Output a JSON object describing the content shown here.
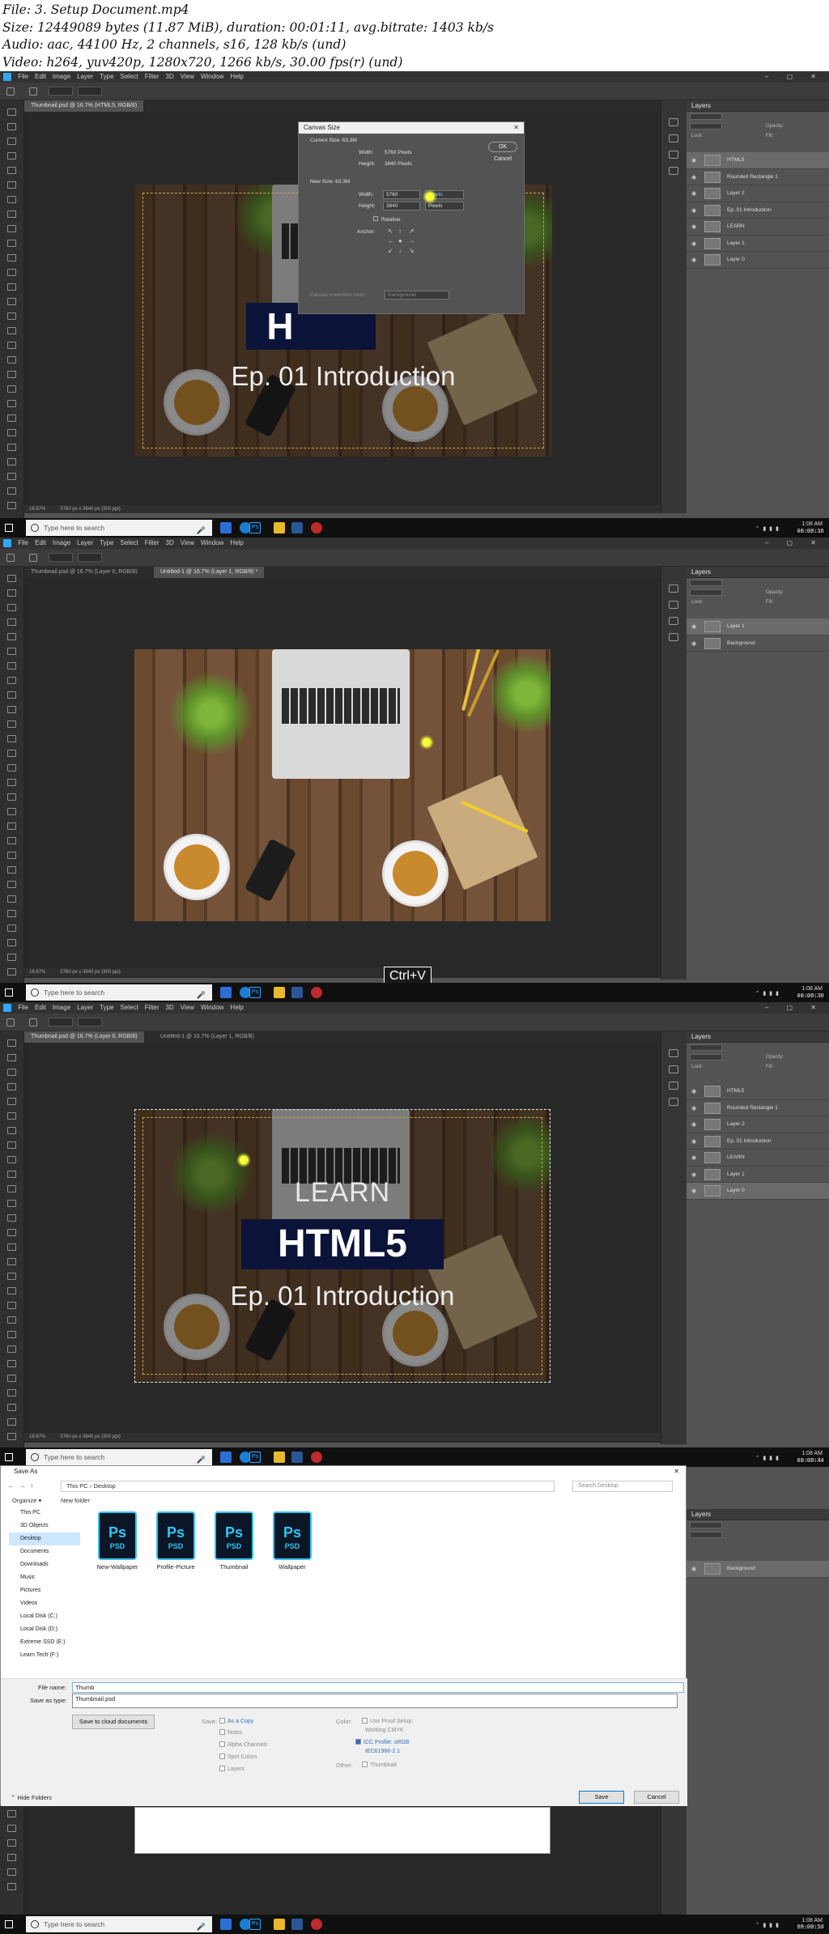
{
  "info": {
    "line1": "File: 3. Setup Document.mp4",
    "line2": "Size: 12449089 bytes (11.87 MiB), duration: 00:01:11, avg.bitrate: 1403 kb/s",
    "line3": "Audio: aac, 44100 Hz, 2 channels, s16, 128 kb/s (und)",
    "line4": "Video: h264, yuv420p, 1280x720, 1266 kb/s, 30.00 fps(r) (und)"
  },
  "menu": [
    "File",
    "Edit",
    "Image",
    "Layer",
    "Type",
    "Select",
    "Filter",
    "3D",
    "View",
    "Window",
    "Help"
  ],
  "winbtns": "– ▢ ✕",
  "layers_title": "Layers",
  "kind_label": "Kind",
  "normal_label": "Normal",
  "opacity_label": "Opacity:",
  "fill_label": "Fill:",
  "lock_label": "Lock:",
  "artwork": {
    "learn": "LEARN",
    "html": "HTML5",
    "ep": "Ep. 01 Introduction",
    "html_cropped": "H"
  },
  "frame1": {
    "tab": "Thumbnail.psd @ 16.7% (HTML5, RGB/8)",
    "status": [
      "16.67%",
      "5760 px x 3840 px (300 ppi)"
    ],
    "timestamp": "00:00:16",
    "layers": [
      "HTML5",
      "Rounded Rectangle 1",
      "Layer 2",
      "Ep. 01 Introduction",
      "LEARN",
      "Layer 1",
      "Layer 0"
    ],
    "dialog": {
      "title": "Canvas Size",
      "current_size": "Current Size: 63.3M",
      "width_label": "Width:",
      "width_val": "5760 Pixels",
      "height_label": "Height:",
      "height_val": "3840 Pixels",
      "new_size": "New Size: 63.3M",
      "new_width": "5760",
      "new_height": "3840",
      "units": "Pixels",
      "relative": "Relative",
      "anchor": "Anchor:",
      "ext_color": "Canvas extension color:",
      "ext_val": "Background",
      "ok": "OK",
      "cancel": "Cancel"
    }
  },
  "frame2": {
    "tabs": [
      "Thumbnail.psd @ 16.7% (Layer 0, RGB/8)",
      "Untitled-1 @ 16.7% (Layer 1, RGB/8) *"
    ],
    "status": [
      "16.67%",
      "5760 px x 3840 px (300 ppi)"
    ],
    "timestamp": "00:00:30",
    "keycap": "Ctrl+V",
    "layers": [
      "Layer 1",
      "Background"
    ]
  },
  "frame3": {
    "tabs": [
      "Thumbnail.psd @ 16.7% (Layer 0, RGB/8)",
      "Untitled-1 @ 16.7% (Layer 1, RGB/8)"
    ],
    "status": [
      "16.67%",
      "5760 px x 3840 px (300 ppi)"
    ],
    "timestamp": "00:00:44",
    "layers": [
      "HTML5",
      "Rounded Rectangle 1",
      "Layer 2",
      "Ep. 01 Introduction",
      "LEARN",
      "Layer 1",
      "Layer 0"
    ]
  },
  "frame4": {
    "timestamp": "00:00:58",
    "layers": [
      "Background"
    ],
    "saveas": {
      "title": "Save As",
      "path": "This PC  ›  Desktop",
      "search": "Search Desktop",
      "organize": "Organize ▾",
      "new_folder": "New folder",
      "sidebar": [
        "This PC",
        "3D Objects",
        "Desktop",
        "Documents",
        "Downloads",
        "Music",
        "Pictures",
        "Videos",
        "Local Disk (C:)",
        "Local Disk (D:)",
        "Extreme SSD (E:)",
        "Learn Tech (F:)"
      ],
      "files": [
        "New-Wallpaper",
        "Profile-Picture",
        "Thumbnail",
        "Wallpaper"
      ],
      "file_name_label": "File name:",
      "file_name": "Thumb",
      "save_type_label": "Save as type:",
      "suggestion": "Thumbnail.psd",
      "cloud_btn": "Save to cloud documents",
      "save_label": "Save:",
      "as_copy": "As a Copy",
      "notes": "Notes",
      "alpha": "Alpha Channels",
      "spot": "Spot Colors",
      "layers_opt": "Layers",
      "color_label": "Color:",
      "use_proof": "Use Proof Setup:",
      "working_cmyk": "Working CMYK",
      "icc": "ICC Profile: sRGB",
      "icc2": "IEC61966-2.1",
      "other_label": "Other:",
      "thumbnail_opt": "Thumbnail",
      "hide_folders": "Hide Folders",
      "save": "Save",
      "cancel": "Cancel"
    }
  },
  "taskbar": {
    "search": "Type here to search",
    "time": "1:08 AM",
    "date": "2/19/2020"
  },
  "ps_icon": "Ps",
  "psd_icon": "PSD"
}
